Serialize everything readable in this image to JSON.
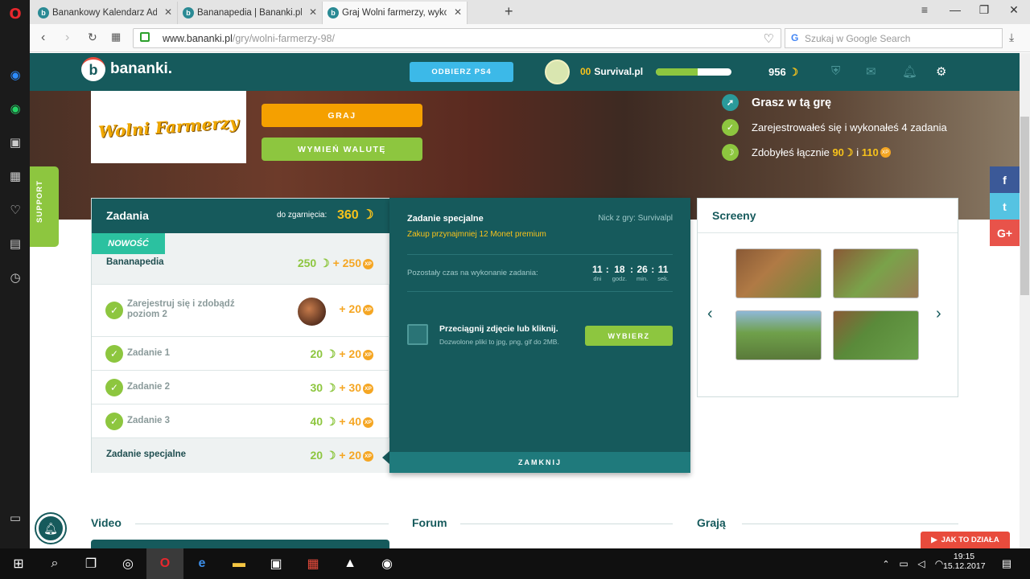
{
  "browser": {
    "tabs": [
      {
        "title": "Banankowy Kalendarz Adw"
      },
      {
        "title": "Bananapedia | Bananki.pl"
      },
      {
        "title": "Graj Wolni farmerzy, wykon"
      }
    ],
    "url_host": "www.bananki.pl",
    "url_path": "/gry/wolni-farmerzy-98/",
    "search_placeholder": "Szukaj w Google Search"
  },
  "header": {
    "logo_text": "bananki.",
    "ps4_button": "ODBIERZ PS4",
    "user_level": "00",
    "user_name": "Survival.pl",
    "xp_progress": 0.55,
    "coins": "956"
  },
  "hero": {
    "game_logo_text": "Wolni Farmerzy",
    "play_button": "GRAJ",
    "exchange_button": "WYMIEŃ WALUTĘ",
    "status_playing": "Grasz w tą grę",
    "status_registered": "Zarejestrowałeś się i wykonałeś 4 zadania",
    "status_earned_prefix": "Zdobyłeś łącznie",
    "earned_bananas": "90",
    "earned_and": "i",
    "earned_xp": "110"
  },
  "support_label": "SUPPORT",
  "tasks": {
    "title": "Zadania",
    "to_win_label": "do zgarnięcia:",
    "to_win_value": "360",
    "new_badge": "NOWOŚĆ",
    "xp_label": "XP",
    "rows": [
      {
        "name": "Bananapedia",
        "bananas": "250",
        "xp": "+ 250"
      },
      {
        "name": "Zarejestruj się i zdobądź poziom 2",
        "bananas": "",
        "xp": "+ 20"
      },
      {
        "name": "Zadanie 1",
        "bananas": "20",
        "xp": "+ 20"
      },
      {
        "name": "Zadanie 2",
        "bananas": "30",
        "xp": "+ 30"
      },
      {
        "name": "Zadanie 3",
        "bananas": "40",
        "xp": "+ 40"
      },
      {
        "name": "Zadanie specjalne",
        "bananas": "20",
        "xp": "+ 20"
      }
    ]
  },
  "special": {
    "title": "Zadanie specjalne",
    "nick": "Nick z gry: Survivalpl",
    "requirement": "Zakup przynajmniej 12 Monet premium",
    "remaining_label": "Pozostały czas na wykonanie zadania:",
    "timer": [
      {
        "value": "11",
        "unit": "dni"
      },
      {
        "value": "18",
        "unit": "godz."
      },
      {
        "value": "26",
        "unit": "min."
      },
      {
        "value": "11",
        "unit": "sek."
      }
    ],
    "upload_text": "Przeciągnij zdjęcie lub kliknij.",
    "allowed_text": "Dozwolone pliki to jpg, png, gif do 2MB.",
    "choose_button": "WYBIERZ",
    "close_button": "ZAMKNIJ"
  },
  "screeny": {
    "title": "Screeny"
  },
  "bottom": {
    "video": "Video",
    "forum": "Forum",
    "playing": "Grają"
  },
  "how_it_works": "JAK TO DZIAŁA",
  "social": {
    "facebook": "f",
    "twitter": "t",
    "gplus": "G+"
  },
  "clock": {
    "time": "19:15",
    "date": "15.12.2017"
  },
  "colors": {
    "teal": "#165a5c",
    "green": "#8dc63f",
    "orange": "#f5a623",
    "yellow": "#f7c21b"
  },
  "icons": [
    "opera-icon",
    "messenger-icon",
    "whatsapp-icon",
    "camera-icon",
    "grid-icon",
    "heart-icon",
    "news-icon",
    "history-icon",
    "shield-icon",
    "mail-icon",
    "bell-icon",
    "gear-icon",
    "windows-start-icon",
    "search-icon",
    "task-view-icon",
    "steam-icon",
    "edge-icon",
    "folder-icon",
    "store-icon",
    "gift-icon",
    "photos-icon"
  ]
}
